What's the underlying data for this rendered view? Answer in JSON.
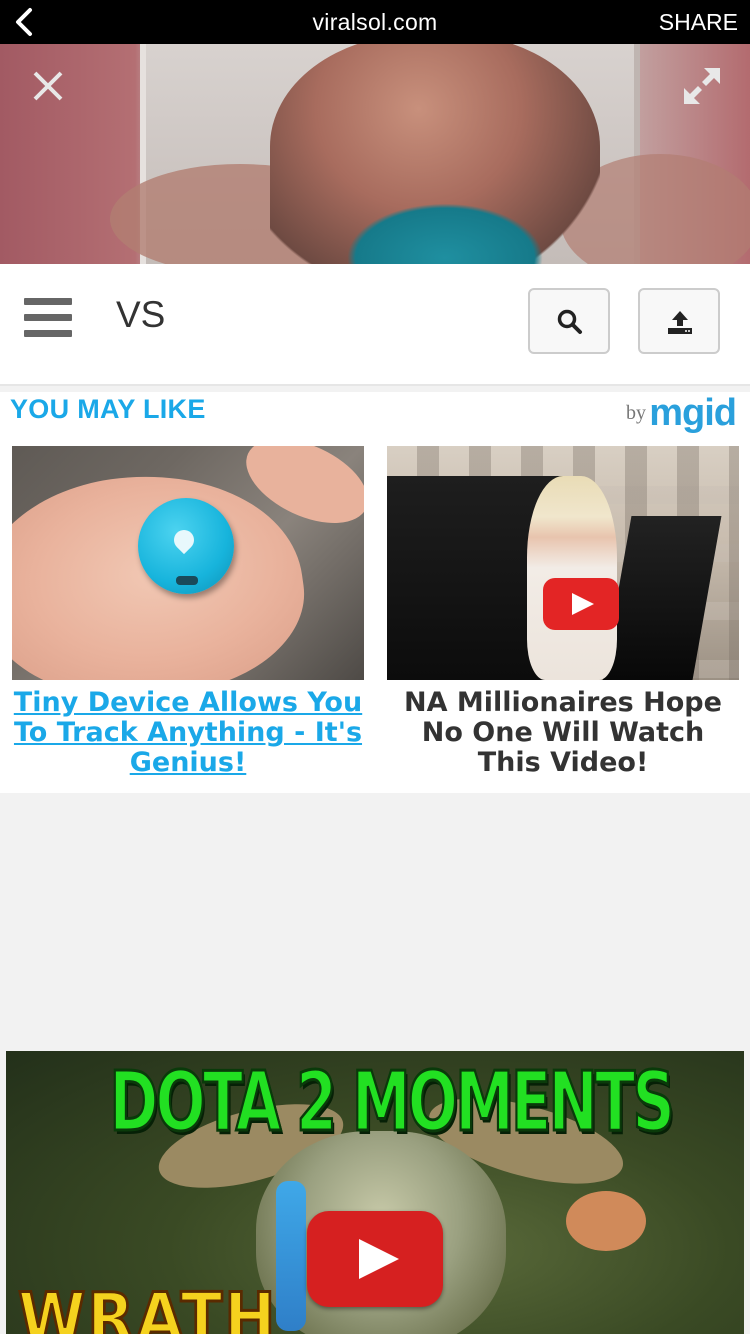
{
  "browser": {
    "url": "viralsol.com",
    "share_label": "SHARE"
  },
  "header": {
    "title": "VS"
  },
  "recommendations": {
    "heading": "YOU MAY LIKE",
    "by_label": "by",
    "provider": "mgid",
    "items": [
      {
        "caption": "Tiny Device Allows You To Track Anything - It's Genius!"
      },
      {
        "caption": "NA Millionaires Hope No One Will Watch This Video!"
      }
    ]
  },
  "video2": {
    "title": "DOTA 2 MOMENTS",
    "subtitle": "WRATH"
  },
  "colors": {
    "accent": "#1aa8e8",
    "play_button": "#e32525",
    "dota_green": "#22e022"
  }
}
